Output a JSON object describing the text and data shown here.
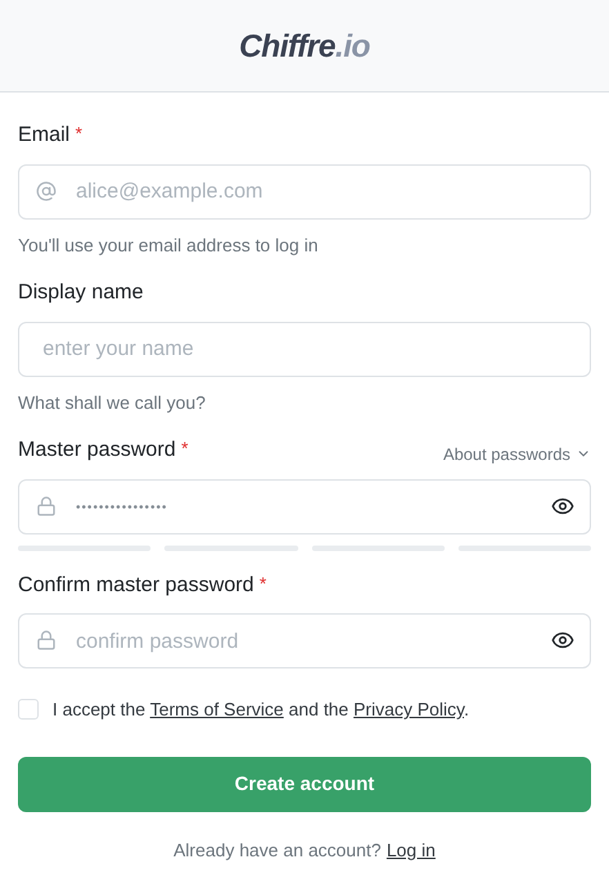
{
  "logo": {
    "name": "Chiffre",
    "suffix": ".io"
  },
  "fields": [
    {
      "kind": "email",
      "label": "Email",
      "required_mark": "*",
      "placeholder": "alice@example.com",
      "help": "You'll use your email address to log in"
    },
    {
      "kind": "text",
      "label": "Display name",
      "placeholder": "enter your name",
      "help": "What shall we call you?"
    },
    {
      "kind": "password",
      "label": "Master password",
      "required_mark": "*",
      "value": "••••••••••••••••",
      "aside": "About passwords",
      "strength_segments": [
        {
          "filled": false
        },
        {
          "filled": false
        },
        {
          "filled": false
        },
        {
          "filled": false
        }
      ]
    },
    {
      "kind": "password",
      "label": "Confirm master password",
      "required_mark": "*",
      "placeholder": "confirm password"
    }
  ],
  "terms": {
    "checked": false,
    "before": "I accept the ",
    "link_1": "Terms of Service",
    "middle": " and the ",
    "link_2": "Privacy Policy",
    "after": "."
  },
  "submit": "Create account",
  "footer": {
    "text": "Already have an account?",
    "link": "Log in"
  }
}
